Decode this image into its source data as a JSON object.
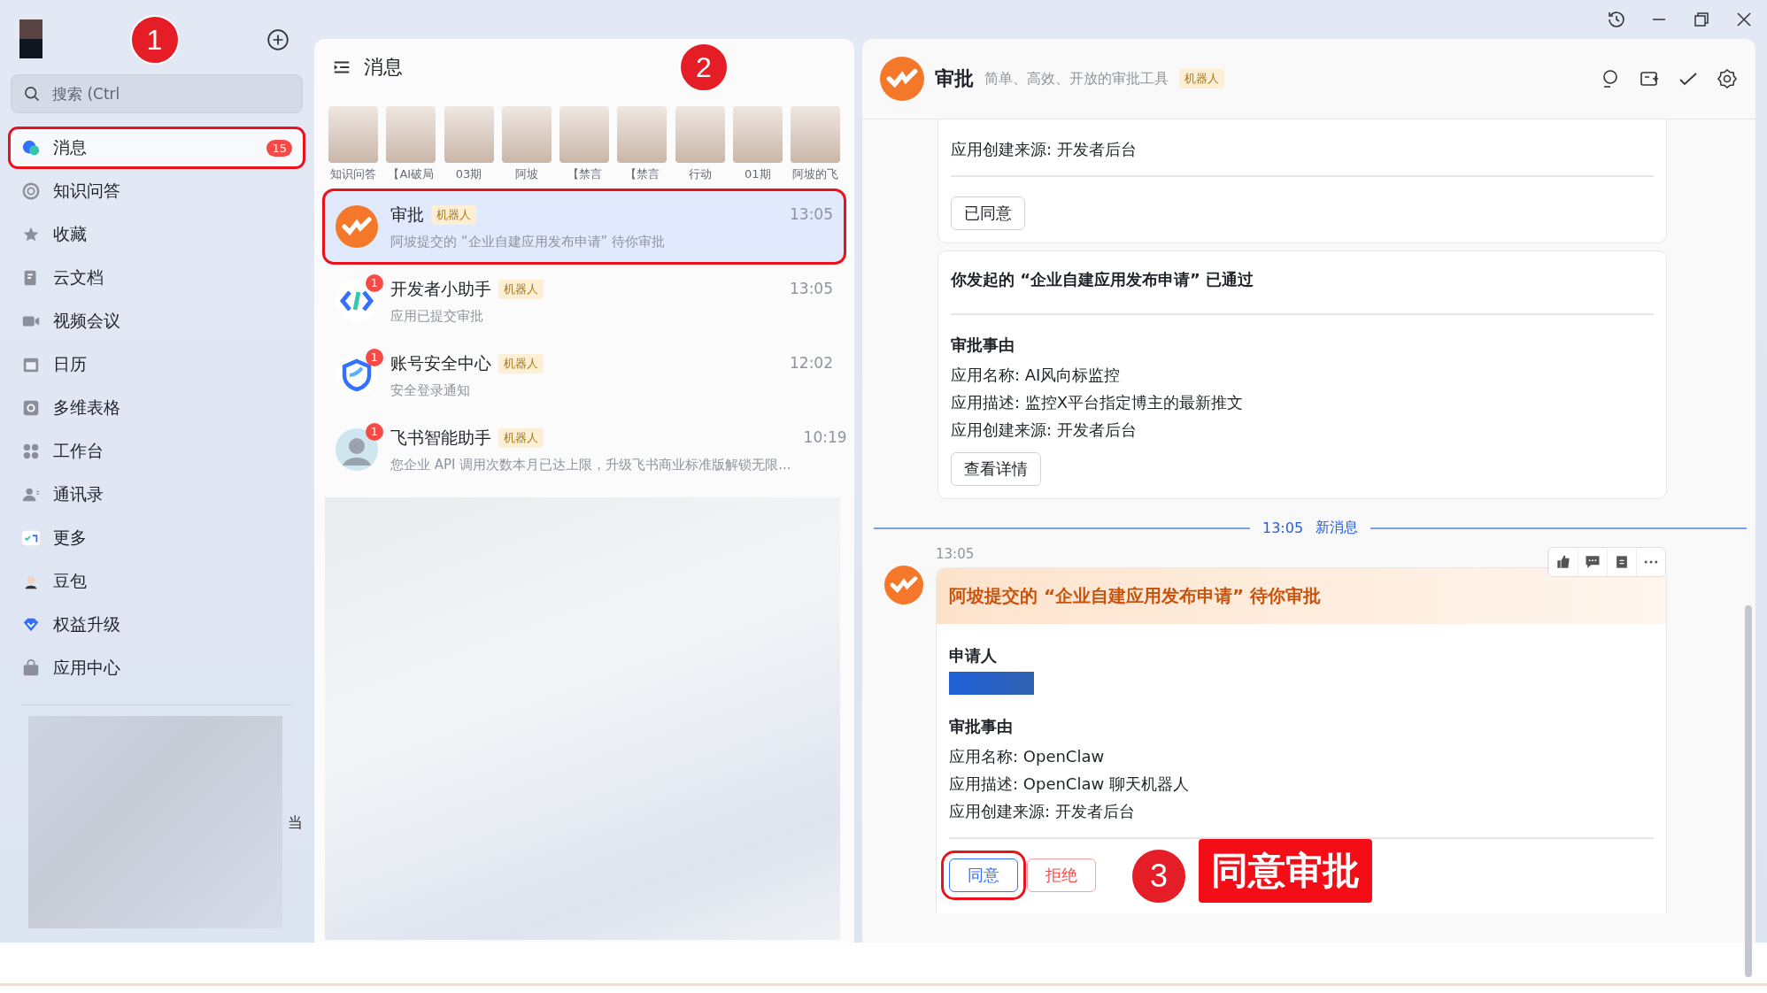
{
  "sidebar": {
    "search": {
      "placeholder": "搜索 (Ctrl"
    },
    "items": [
      {
        "label": "消息",
        "selected": true,
        "badge": "15",
        "marker": "1"
      },
      {
        "label": "知识问答",
        "selected": false
      },
      {
        "label": "收藏",
        "selected": false
      },
      {
        "label": "云文档",
        "selected": false
      },
      {
        "label": "视频会议",
        "selected": false
      },
      {
        "label": "日历",
        "selected": false
      },
      {
        "label": "多维表格",
        "selected": false
      },
      {
        "label": "工作台",
        "selected": false
      },
      {
        "label": "通讯录",
        "selected": false
      },
      {
        "label": "更多",
        "selected": false
      },
      {
        "label": "豆包",
        "selected": false
      },
      {
        "label": "权益升级",
        "selected": false
      },
      {
        "label": "应用中心",
        "selected": false
      }
    ],
    "edge_text": "当"
  },
  "message_list": {
    "title": "消息",
    "pinned": [
      "知识问答",
      "【AI破局",
      "03期",
      "阿坡",
      "【禁言",
      "【禁言",
      "行动",
      "01期",
      "阿坡的飞"
    ],
    "chats": [
      {
        "name": "审批",
        "tag": "机器人",
        "time": "13:05",
        "preview": "阿坡提交的 “企业自建应用发布申请” 待你审批",
        "selected": true,
        "marker": "2"
      },
      {
        "name": "开发者小助手",
        "tag": "机器人",
        "time": "13:05",
        "preview": "应用已提交审批",
        "selected": false,
        "unread": "1"
      },
      {
        "name": "账号安全中心",
        "tag": "机器人",
        "time": "12:02",
        "preview": "安全登录通知",
        "selected": false,
        "unread": "1"
      },
      {
        "name": "飞书智能助手",
        "tag": "机器人",
        "time": "10:19",
        "preview": "您企业 API 调用次数本月已达上限，升级飞书商业标准版解锁无限...",
        "selected": false,
        "unread": "1"
      }
    ]
  },
  "chat": {
    "title": "审批",
    "subtitle": "简单、高效、开放的审批工具",
    "tag": "机器人",
    "history": [
      {
        "kind": "tail",
        "lines": [
          "应用创建来源: 开发者后台"
        ],
        "buttons": [
          "已同意"
        ]
      },
      {
        "kind": "full",
        "title": "你发起的 “企业自建应用发布申请” 已通过",
        "section": "审批事由",
        "lines": [
          "应用名称: AI风向标监控",
          "应用描述: 监控X平台指定博主的最新推文",
          "应用创建来源: 开发者后台"
        ],
        "buttons": [
          "查看详情"
        ]
      }
    ],
    "divider": {
      "time": "13:05",
      "label": "新消息"
    },
    "latest": {
      "time": "13:05",
      "title": "阿坡提交的 “企业自建应用发布申请” 待你审批",
      "applicant_label": "申请人",
      "section": "审批事由",
      "lines": [
        "应用名称: OpenClaw",
        "应用描述: OpenClaw 聊天机器人",
        "应用创建来源: 开发者后台"
      ],
      "buttons": [
        {
          "label": "同意",
          "kind": "approve",
          "marker": "3",
          "callout": "同意审批"
        },
        {
          "label": "拒绝",
          "kind": "reject"
        }
      ]
    }
  }
}
